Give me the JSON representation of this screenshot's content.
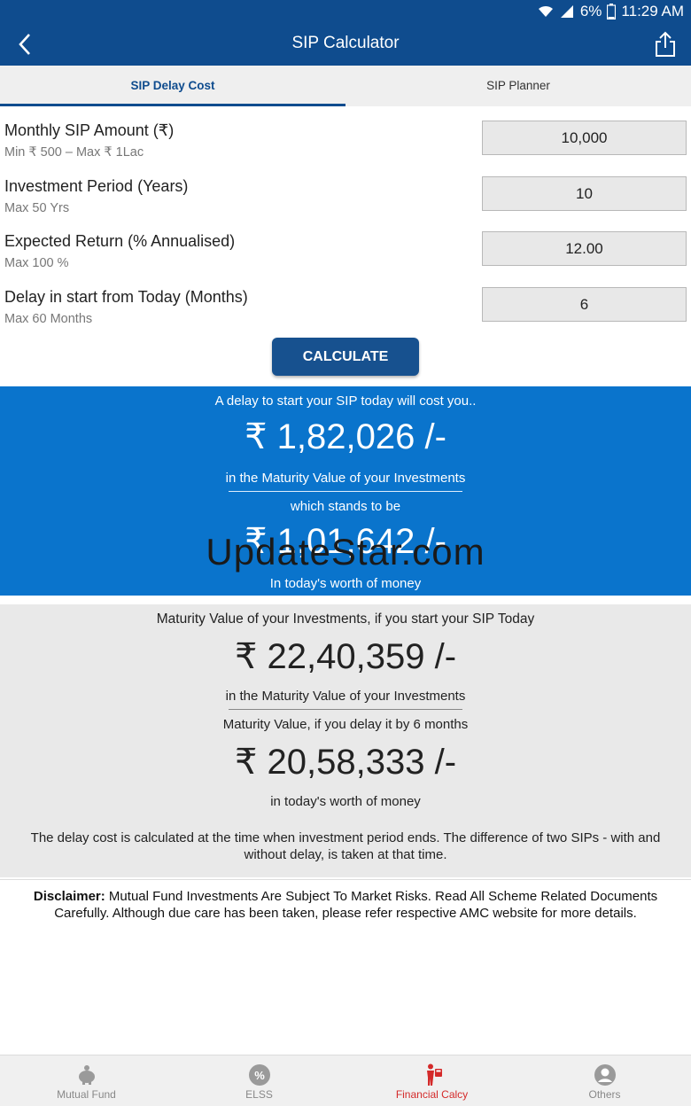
{
  "status_bar": {
    "battery": "6%",
    "time": "11:29 AM"
  },
  "app_bar": {
    "title": "SIP Calculator"
  },
  "tabs": [
    {
      "label": "SIP Delay Cost",
      "active": true
    },
    {
      "label": "SIP Planner",
      "active": false
    }
  ],
  "form": {
    "rows": [
      {
        "label": "Monthly SIP Amount (₹)",
        "hint": "Min ₹ 500 – Max ₹ 1Lac",
        "value": "10,000"
      },
      {
        "label": "Investment Period (Years)",
        "hint": "Max 50 Yrs",
        "value": "10"
      },
      {
        "label": "Expected Return (% Annualised)",
        "hint": "Max 100 %",
        "value": "12.00"
      },
      {
        "label": "Delay in start from Today (Months)",
        "hint": "Max 60 Months",
        "value": "6"
      }
    ],
    "calculate_label": "CALCULATE"
  },
  "delay_result": {
    "intro": "A delay to start your SIP today will cost you..",
    "cost_amount": "₹ 1,82,026 /-",
    "cost_caption": "in the Maturity Value of your Investments",
    "stands_text": "which stands to be",
    "present_amount": "₹ 1,01,642 /-",
    "present_caption": "In today's worth of money",
    "watermark": "UpdateStar.com"
  },
  "maturity_result": {
    "today_heading": "Maturity Value of your Investments, if you start your SIP Today",
    "today_amount": "₹ 22,40,359 /-",
    "today_caption": "in the Maturity Value of your Investments",
    "delay_heading": "Maturity Value, if you delay it by 6 months",
    "delay_amount": "₹ 20,58,333 /-",
    "delay_caption": "in today's worth of money",
    "note": "The delay cost is calculated at the time when investment period ends. The difference of two SIPs - with and without delay, is taken at that time."
  },
  "disclaimer": {
    "title": "Disclaimer:",
    "text": " Mutual Fund Investments Are Subject To Market Risks. Read All Scheme Related Documents Carefully. Although due care has been taken, please refer respective AMC website for more details."
  },
  "bottom_nav": [
    {
      "label": "Mutual Fund",
      "icon": "piggy-bank-icon"
    },
    {
      "label": "ELSS",
      "icon": "percent-badge-icon"
    },
    {
      "label": "Financial Calcy",
      "icon": "person-calculator-icon"
    },
    {
      "label": "Others",
      "icon": "user-circle-icon"
    }
  ],
  "colors": {
    "primary": "#0f4c8e",
    "result_blue": "#0a74cc",
    "active_nav": "#d42a2a"
  }
}
